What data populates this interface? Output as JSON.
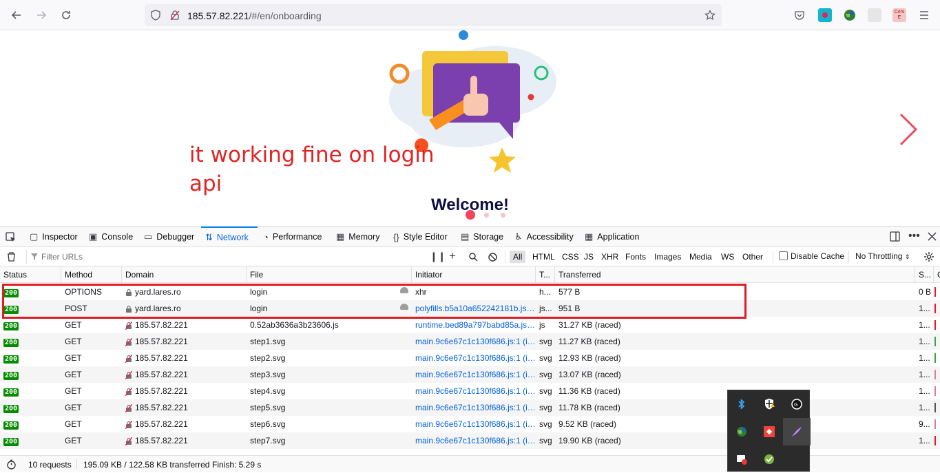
{
  "browser": {
    "url_host": "185.57.82.221",
    "url_path": "/#/en/onboarding",
    "ext_cors_label": "Cors"
  },
  "page": {
    "annotation": "it working fine on login api",
    "welcome": "Welcome!"
  },
  "devtools": {
    "tabs": [
      {
        "label": "Inspector",
        "icon": "inspector-icon"
      },
      {
        "label": "Console",
        "icon": "console-icon"
      },
      {
        "label": "Debugger",
        "icon": "debugger-icon"
      },
      {
        "label": "Network",
        "icon": "network-icon",
        "active": true
      },
      {
        "label": "Performance",
        "icon": "performance-icon"
      },
      {
        "label": "Memory",
        "icon": "memory-icon"
      },
      {
        "label": "Style Editor",
        "icon": "style-editor-icon"
      },
      {
        "label": "Storage",
        "icon": "storage-icon"
      },
      {
        "label": "Accessibility",
        "icon": "accessibility-icon"
      },
      {
        "label": "Application",
        "icon": "application-icon"
      }
    ],
    "filter_placeholder": "Filter URLs",
    "filter_types": [
      "All",
      "HTML",
      "CSS",
      "JS",
      "XHR",
      "Fonts",
      "Images",
      "Media",
      "WS",
      "Other"
    ],
    "disable_cache": "Disable Cache",
    "throttling": "No Throttling",
    "columns": [
      "Status",
      "Method",
      "Domain",
      "File",
      "Initiator",
      "T...",
      "Transferred",
      "S...",
      "C"
    ],
    "requests": [
      {
        "status": "200",
        "method": "OPTIONS",
        "domain": "yard.lares.ro",
        "secure": true,
        "file": "login",
        "initiator": "xhr",
        "initiator_link": false,
        "type": "h...",
        "transferred": "577 B",
        "size": "0 B",
        "bar": "#e01b24"
      },
      {
        "status": "200",
        "method": "POST",
        "domain": "yard.lares.ro",
        "secure": true,
        "file": "login",
        "initiator": "polyfills.b5a10a652242181b.js:1...",
        "initiator_link": true,
        "type": "js...",
        "transferred": "951 B",
        "size": "1...",
        "bar": "#e01b24"
      },
      {
        "status": "200",
        "method": "GET",
        "domain": "185.57.82.221",
        "secure": false,
        "file": "0.52ab3636a3b23606.js",
        "initiator": "runtime.bed89a797babd85a.js:...",
        "initiator_link": true,
        "type": "js",
        "transferred": "31.27 KB (raced)",
        "size": "1...",
        "bar": "#e01b24"
      },
      {
        "status": "200",
        "method": "GET",
        "domain": "185.57.82.221",
        "secure": false,
        "file": "step1.svg",
        "initiator": "main.9c6e67c1c130f686.js:1 (img)",
        "initiator_link": true,
        "type": "svg",
        "transferred": "11.27 KB (raced)",
        "size": "1...",
        "bar": "#3fa33f"
      },
      {
        "status": "200",
        "method": "GET",
        "domain": "185.57.82.221",
        "secure": false,
        "file": "step2.svg",
        "initiator": "main.9c6e67c1c130f686.js:1 (img)",
        "initiator_link": true,
        "type": "svg",
        "transferred": "12.93 KB (raced)",
        "size": "1...",
        "bar": "#3fa33f"
      },
      {
        "status": "200",
        "method": "GET",
        "domain": "185.57.82.221",
        "secure": false,
        "file": "step3.svg",
        "initiator": "main.9c6e67c1c130f686.js:1 (img)",
        "initiator_link": true,
        "type": "svg",
        "transferred": "13.07 KB (raced)",
        "size": "1...",
        "bar": "#e07a9b"
      },
      {
        "status": "200",
        "method": "GET",
        "domain": "185.57.82.221",
        "secure": false,
        "file": "step4.svg",
        "initiator": "main.9c6e67c1c130f686.js:1 (img)",
        "initiator_link": true,
        "type": "svg",
        "transferred": "11.36 KB (raced)",
        "size": "1...",
        "bar": "#e07a9b"
      },
      {
        "status": "200",
        "method": "GET",
        "domain": "185.57.82.221",
        "secure": false,
        "file": "step5.svg",
        "initiator": "main.9c6e67c1c130f686.js:1 (img)",
        "initiator_link": true,
        "type": "svg",
        "transferred": "11.78 KB (raced)",
        "size": "1...",
        "bar": "#555555"
      },
      {
        "status": "200",
        "method": "GET",
        "domain": "185.57.82.221",
        "secure": false,
        "file": "step6.svg",
        "initiator": "main.9c6e67c1c130f686.js:1 (img)",
        "initiator_link": true,
        "type": "svg",
        "transferred": "9.52 KB (raced)",
        "size": "9...",
        "bar": "#e07a9b"
      },
      {
        "status": "200",
        "method": "GET",
        "domain": "185.57.82.221",
        "secure": false,
        "file": "step7.svg",
        "initiator": "main.9c6e67c1c130f686.js:1 (img)",
        "initiator_link": true,
        "type": "svg",
        "transferred": "19.90 KB (raced)",
        "size": "1...",
        "bar": "#e01b24"
      }
    ],
    "summary": {
      "requests": "10 requests",
      "transferred": "195.09 KB / 122.58 KB transferred",
      "finish": "Finish: 5.29 s"
    }
  }
}
